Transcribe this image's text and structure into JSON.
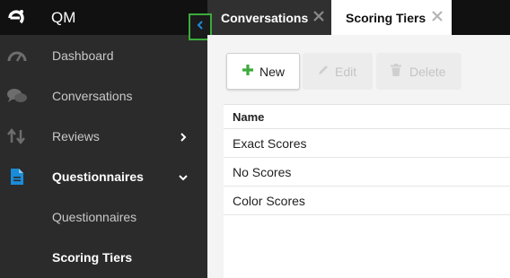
{
  "app": {
    "name": "QM"
  },
  "sidebar": {
    "items": [
      {
        "label": "Dashboard"
      },
      {
        "label": "Conversations"
      },
      {
        "label": "Reviews"
      },
      {
        "label": "Questionnaires"
      }
    ],
    "subitems": [
      {
        "label": "Questionnaires"
      },
      {
        "label": "Scoring Tiers"
      }
    ]
  },
  "tabs": [
    {
      "label": "Conversations"
    },
    {
      "label": "Scoring Tiers"
    }
  ],
  "toolbar": {
    "new_label": "New",
    "edit_label": "Edit",
    "delete_label": "Delete"
  },
  "table": {
    "header": "Name",
    "rows": [
      "Exact Scores",
      "No Scores",
      "Color Scores"
    ]
  },
  "colors": {
    "sidebar_bg": "#2b2b2b",
    "topbar_bg": "#111111",
    "accent_blue": "#1a8cd8",
    "accent_green": "#3cab3c"
  }
}
